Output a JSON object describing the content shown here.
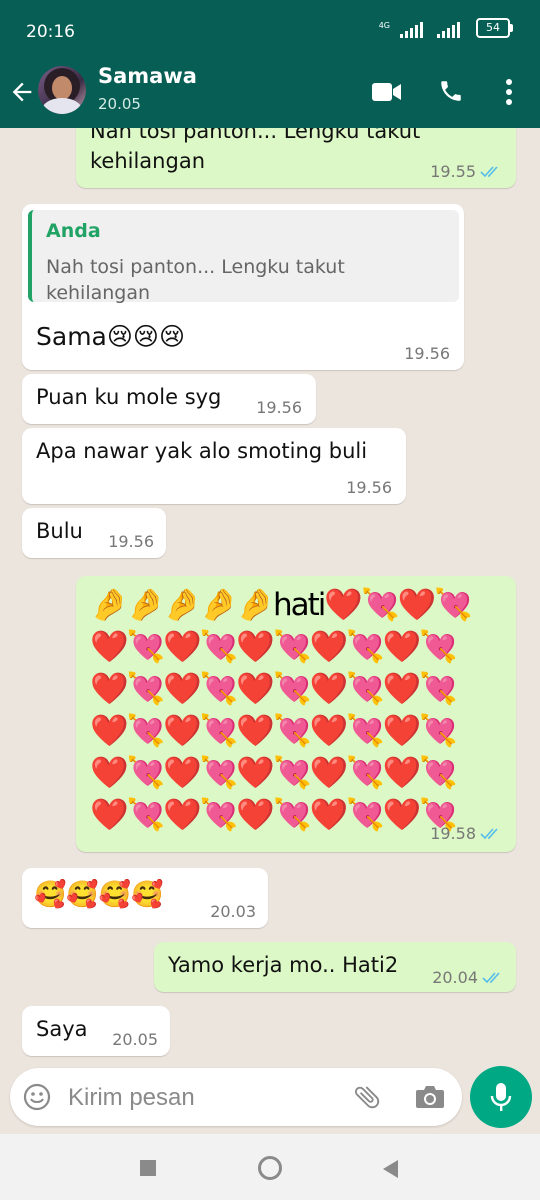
{
  "status_bar": {
    "time": "20:16",
    "network": "4G",
    "battery": "54"
  },
  "header": {
    "contact_name": "Samawa",
    "last_seen": "20.05"
  },
  "messages": [
    {
      "dir": "out",
      "text": "Nah tosi panton... Lengku takut\nkehilangan",
      "time": "19.55",
      "read": true
    },
    {
      "dir": "in",
      "quote_author": "Anda",
      "quote_text": "Nah tosi panton... Lengku takut kehilangan",
      "text": "Sama😢😢😢",
      "time": "19.56"
    },
    {
      "dir": "in",
      "text": "Puan ku mole syg",
      "time": "19.56"
    },
    {
      "dir": "in",
      "text": "Apa nawar yak alo smoting buli",
      "time": "19.56"
    },
    {
      "dir": "in",
      "text": "Bulu",
      "time": "19.56"
    },
    {
      "dir": "out",
      "text": "🤌🤌🤌🤌🤌hati❤️💘❤️💘❤️💘❤️💘❤️💘❤️💘❤️💘❤️💘❤️💘❤️💘❤️💘❤️💘❤️💘❤️💘❤️💘❤️💘❤️💘❤️💘❤️💘❤️💘❤️💘❤️💘❤️💘❤️💘❤️💘❤️💘❤️💘",
      "time": "19.58",
      "read": true
    },
    {
      "dir": "in",
      "text": "🥰🥰🥰🥰",
      "time": "20.03"
    },
    {
      "dir": "out",
      "text": "Yamo kerja mo.. Hati2",
      "time": "20.04",
      "read": true
    },
    {
      "dir": "in",
      "text": "Saya",
      "time": "20.05"
    }
  ],
  "composer": {
    "placeholder": "Kirim pesan"
  },
  "colors": {
    "header": "#075e54",
    "outgoing": "#dcf8c6",
    "incoming": "#ffffff",
    "accent": "#00a884",
    "read_tick": "#53bdeb"
  }
}
